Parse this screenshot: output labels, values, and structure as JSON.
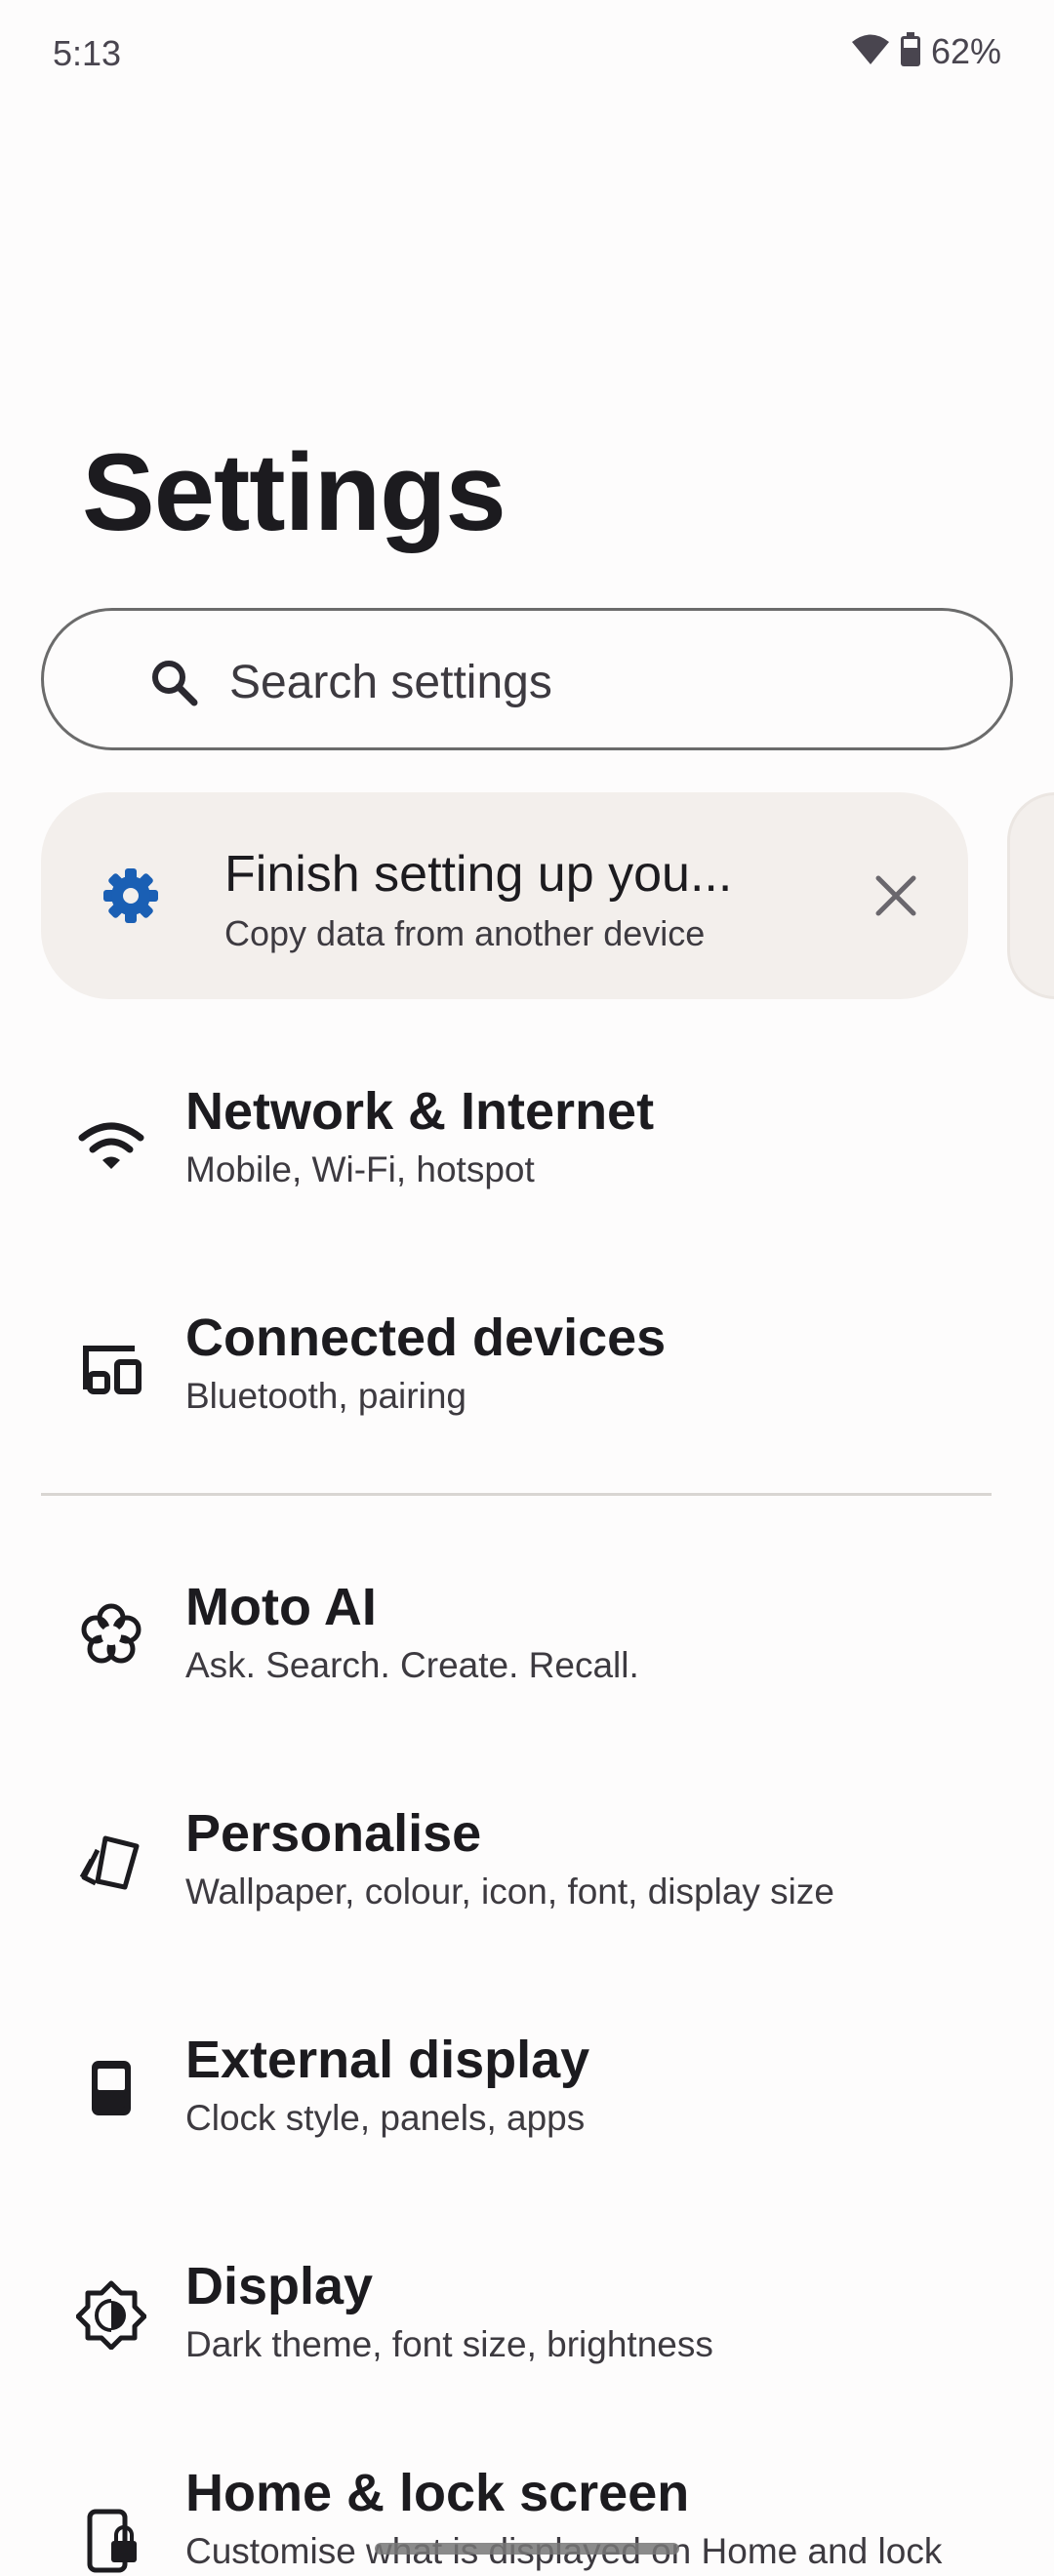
{
  "status_bar": {
    "time": "5:13",
    "battery_percent": "62%",
    "icons": [
      "wifi-icon",
      "battery-icon"
    ]
  },
  "page": {
    "title": "Settings"
  },
  "search": {
    "placeholder": "Search settings",
    "icon": "search-icon"
  },
  "suggestion": {
    "title": "Finish setting up you...",
    "subtitle": "Copy data from another device",
    "icon": "gear-icon",
    "accent_color": "#1a5fb4",
    "dismiss_icon": "close-icon"
  },
  "settings": [
    {
      "title": "Network & Internet",
      "subtitle": "Mobile, Wi-Fi, hotspot",
      "icon": "wifi-icon"
    },
    {
      "title": "Connected devices",
      "subtitle": "Bluetooth, pairing",
      "icon": "devices-icon"
    },
    {
      "title": "Moto AI",
      "subtitle": "Ask. Search. Create. Recall.",
      "icon": "ai-flower-icon"
    },
    {
      "title": "Personalise",
      "subtitle": "Wallpaper, colour, icon, font, display size",
      "icon": "palette-cards-icon"
    },
    {
      "title": "External display",
      "subtitle": "Clock style, panels, apps",
      "icon": "external-display-icon"
    },
    {
      "title": "Display",
      "subtitle": "Dark theme, font size, brightness",
      "icon": "brightness-icon"
    },
    {
      "title": "Home & lock screen",
      "subtitle": "Customise what is displayed on Home and lock",
      "icon": "phone-lock-icon"
    }
  ],
  "colors": {
    "background": "#fdfcfc",
    "card_background": "#f3efec",
    "text_primary": "#1c1b1f",
    "text_secondary": "#3d3a40"
  }
}
